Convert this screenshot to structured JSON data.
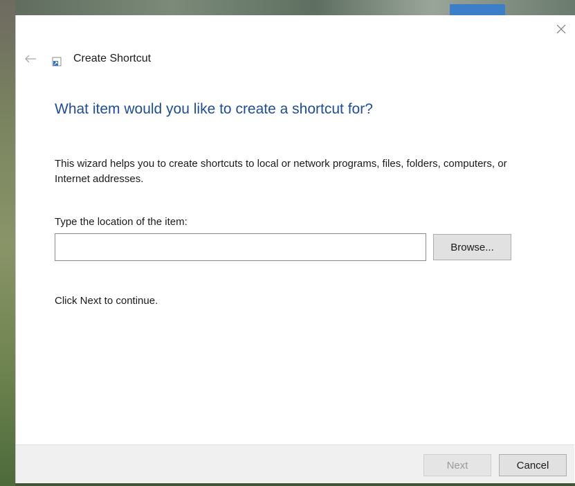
{
  "window": {
    "title": "Create Shortcut",
    "title_icon": "shortcut-icon",
    "close_icon": "close-icon",
    "back_icon": "back-arrow-icon"
  },
  "main": {
    "heading": "What item would you like to create a shortcut for?",
    "description": "This wizard helps you to create shortcuts to local or network programs, files, folders, computers, or Internet addresses.",
    "location_label": "Type the location of the item:",
    "location_value": "",
    "location_placeholder": "",
    "browse_label": "Browse...",
    "hint": "Click Next to continue."
  },
  "footer": {
    "next_label": "Next",
    "cancel_label": "Cancel"
  },
  "colors": {
    "heading": "#1e4c9a",
    "dialog_bg": "#ffffff",
    "footer_bg": "#f0f0f0"
  }
}
